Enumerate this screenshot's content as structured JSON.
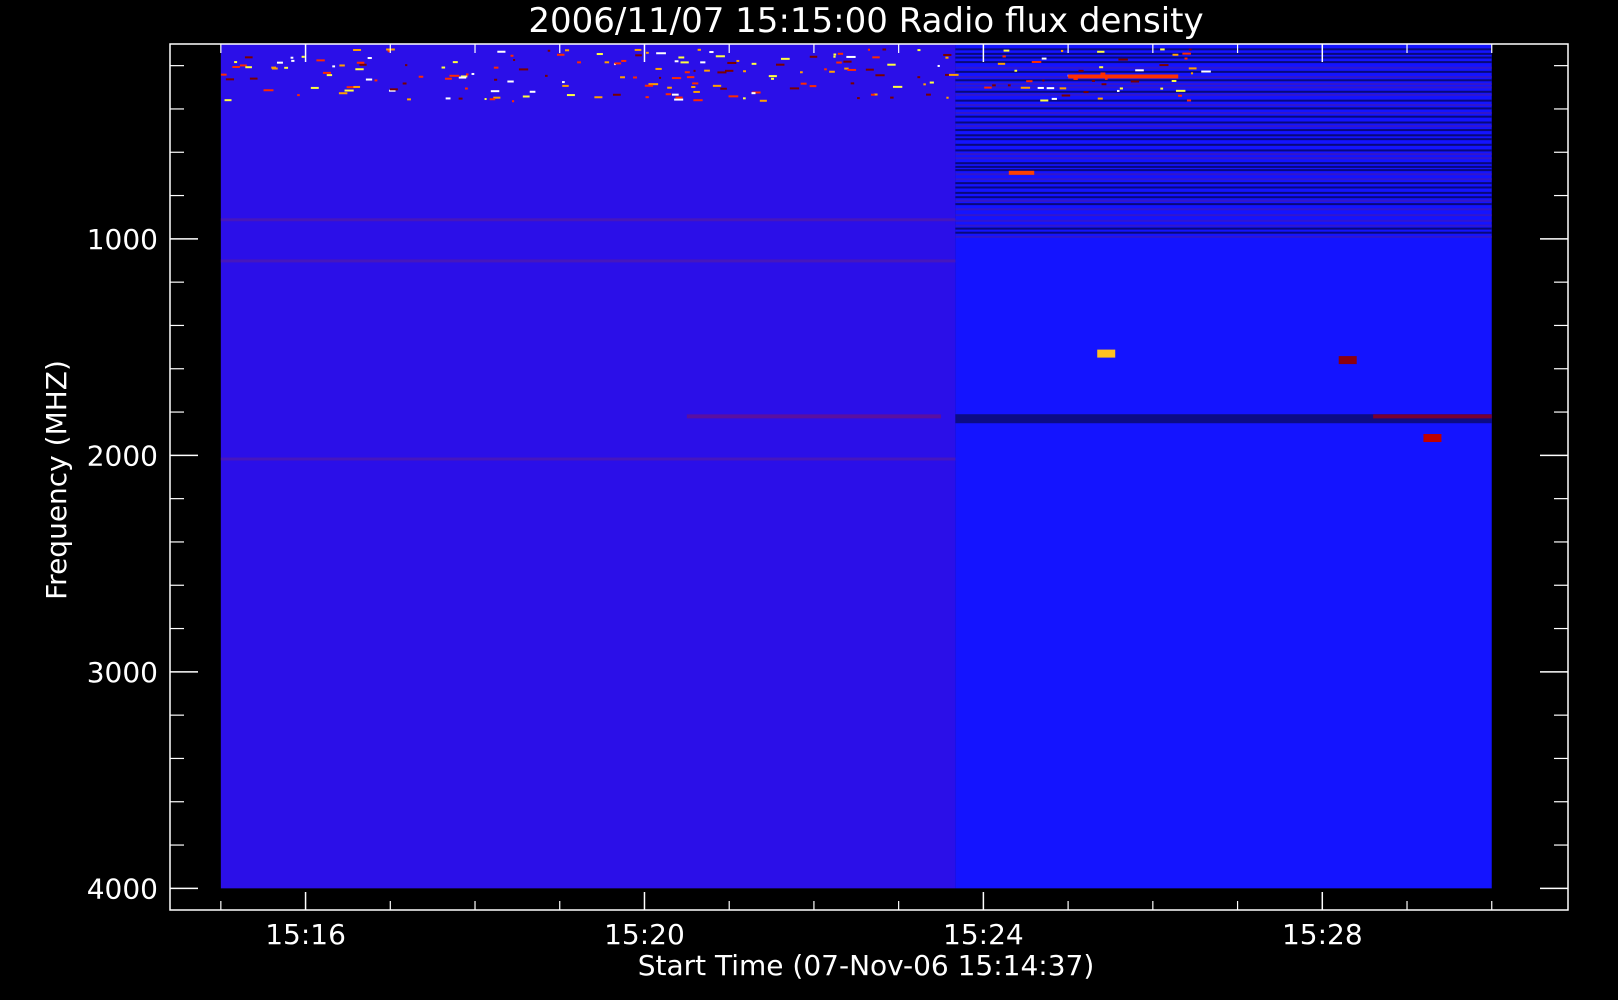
{
  "chart_data": {
    "type": "heatmap",
    "title": "2006/11/07 15:15:00 Radio flux density",
    "xlabel": "Start Time (07-Nov-06 15:14:37)",
    "ylabel": "Frequency (MHZ)",
    "x_ticks": [
      {
        "label": "15:16",
        "minutes": 16
      },
      {
        "label": "15:20",
        "minutes": 20
      },
      {
        "label": "15:24",
        "minutes": 24
      },
      {
        "label": "15:28",
        "minutes": 28
      }
    ],
    "y_ticks": [
      1000,
      2000,
      3000,
      4000
    ],
    "xlim_minutes": [
      14.4,
      30.9
    ],
    "ylim": [
      100,
      4100
    ],
    "y_inverted": true,
    "data_time_range_minutes": [
      15.0,
      30.0
    ],
    "data_freq_range": [
      100,
      4000
    ],
    "colormap": [
      "#000000",
      "#1414ff",
      "#7a0000",
      "#ff2a00",
      "#ffff40",
      "#ffffff"
    ],
    "background_levels": {
      "before_15_23_40": "#2b0fe8",
      "after_15_23_40": "#1414ff"
    },
    "time_split_minutes": 23.67,
    "features": [
      {
        "kind": "burst",
        "time_minutes": 25.45,
        "freq": 1530,
        "color": "#ffc020"
      },
      {
        "kind": "burst",
        "time_minutes": 28.3,
        "freq": 1560,
        "color": "#8a0010"
      },
      {
        "kind": "burst",
        "time_minutes": 29.3,
        "freq": 1920,
        "color": "#c00000"
      },
      {
        "kind": "streak",
        "time_start": 25.0,
        "time_end": 26.3,
        "freq": 250,
        "color": "#ff3000"
      },
      {
        "kind": "streak",
        "time_start": 24.3,
        "time_end": 24.6,
        "freq": 695,
        "color": "#ff4000"
      },
      {
        "kind": "streak",
        "time_start": 28.6,
        "time_end": 30.0,
        "freq": 1820,
        "color": "#7a0030"
      },
      {
        "kind": "streak",
        "time_start": 20.5,
        "time_end": 23.5,
        "freq": 1820,
        "color": "#5a10a0"
      }
    ],
    "grid": false,
    "legend": "none"
  },
  "colors": {
    "background": "#000000",
    "foreground": "#ffffff"
  }
}
